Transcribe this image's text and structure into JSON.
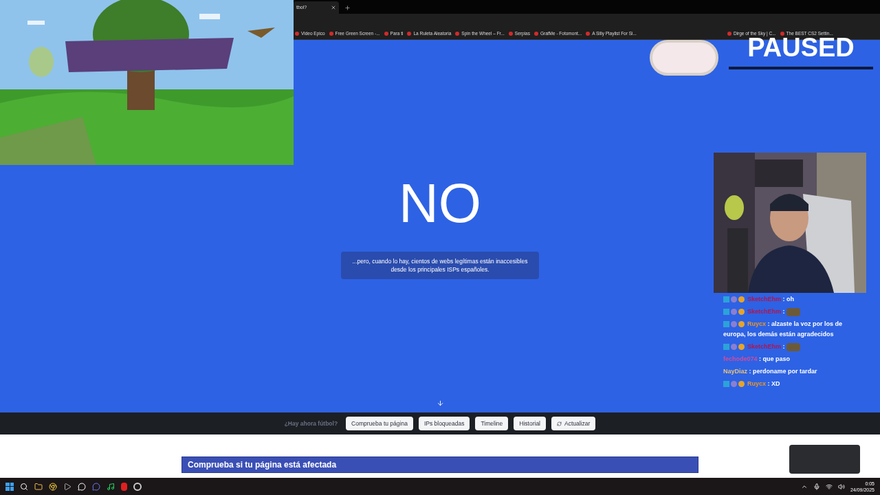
{
  "browser": {
    "tab": {
      "title": "tbol?"
    },
    "bookmarks": [
      "Video Epico",
      "Free Green Screen -...",
      "Para ti",
      "La Ruleta Aleatoria",
      "Spin the Wheel – Fr...",
      "Serpias",
      "GrafMe - Fotomont...",
      "A Silly Playlist For Si..."
    ],
    "bookmarks_right": [
      "Dirge of the Sky | C...",
      "The BEST CS2 Settin..."
    ]
  },
  "page": {
    "headline": "NO",
    "notice": "...pero, cuando lo hay, cientos de webs legítimas están inaccesibles desde los principales ISPs españoles.",
    "nav": {
      "label": "¿Hay ahora fútbol?",
      "buttons": [
        {
          "label": "Comprueba tu página",
          "kind": "plain"
        },
        {
          "label": "IPs bloqueadas",
          "kind": "plain"
        },
        {
          "label": "Timeline",
          "kind": "plain"
        },
        {
          "label": "Historial",
          "kind": "plain"
        },
        {
          "label": "Actualizar",
          "kind": "refresh"
        }
      ]
    },
    "section_title": "Comprueba si tu página está afectada"
  },
  "stream_overlay": {
    "status": "PAUSED",
    "separator": ":",
    "chat": [
      {
        "user": "SketchEhm",
        "color": "#b3154c",
        "badges": true,
        "kind": "text",
        "message": "oh"
      },
      {
        "user": "SketchEhm",
        "color": "#b3154c",
        "badges": true,
        "kind": "emote"
      },
      {
        "user": "Ruycx",
        "color": "#e8962a",
        "badges": true,
        "kind": "text",
        "message": "alzaste la voz por los de europa, los demás están agradecidos"
      },
      {
        "user": "SketchEhm",
        "color": "#b3154c",
        "badges": true,
        "kind": "emote"
      },
      {
        "user": "fechode074",
        "color": "#d34b9c",
        "badges": false,
        "kind": "text",
        "message": "que paso"
      },
      {
        "user": "NayDiaz",
        "color": "#e8c27a",
        "badges": false,
        "kind": "text",
        "message": "perdoname por tardar"
      },
      {
        "user": "Ruycx",
        "color": "#e8962a",
        "badges": true,
        "kind": "text",
        "message": "XD"
      }
    ]
  },
  "taskbar": {
    "time": "0:05",
    "date": "24/09/2025"
  }
}
